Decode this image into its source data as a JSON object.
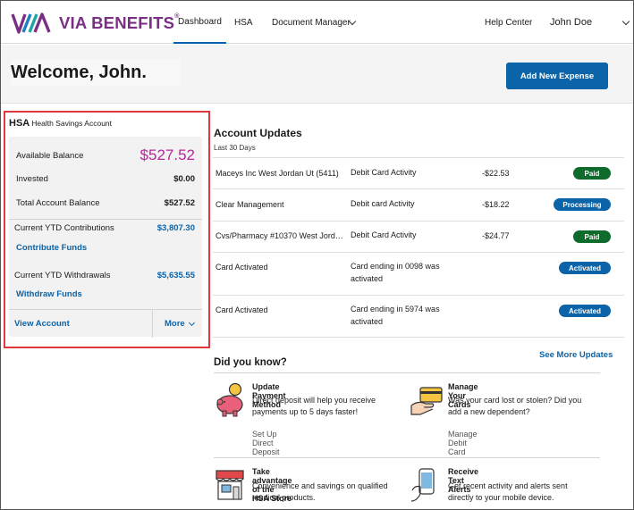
{
  "brand": {
    "name": "VIA BENEFITS",
    "mark": "®"
  },
  "nav": {
    "dashboard": "Dashboard",
    "hsa": "HSA",
    "document_manager": "Document Manager",
    "help_center": "Help Center",
    "user_name": "John Doe"
  },
  "welcome": {
    "text": "Welcome, John.",
    "add_expense": "Add New Expense"
  },
  "hsa": {
    "title": "HSA",
    "subtitle": "Health Savings Account",
    "available_label": "Available Balance",
    "available_value": "$527.52",
    "invested_label": "Invested",
    "invested_value": "$0.00",
    "total_label": "Total Account Balance",
    "total_value": "$527.52",
    "contrib_label": "Current YTD Contributions",
    "contrib_value": "$3,807.30",
    "contrib_link": "Contribute Funds",
    "withdraw_label": "Current YTD Withdrawals",
    "withdraw_value": "$5,635.55",
    "withdraw_link": "Withdraw Funds",
    "view_account": "View Account",
    "more": "More"
  },
  "updates": {
    "title": "Account Updates",
    "subtitle": "Last 30 Days",
    "see_more": "See More Updates",
    "rows": [
      {
        "merchant": "Maceys Inc West Jordan Ut (5411)",
        "type": "Debit Card Activity",
        "amount": "-$22.53",
        "status": "Paid"
      },
      {
        "merchant": "Clear Management",
        "type": "Debit card Activity",
        "amount": "-$18.22",
        "status": "Processing"
      },
      {
        "merchant": "Cvs/Pharmacy #10370 West Jord…",
        "type": "Debit Card Activity",
        "amount": "-$24.77",
        "status": "Paid"
      },
      {
        "merchant": "Card Activated",
        "type": "Card ending in 0098 was activated",
        "amount": "",
        "status": "Activated"
      },
      {
        "merchant": "Card Activated",
        "type": "Card ending in 5974 was activated",
        "amount": "",
        "status": "Activated"
      }
    ]
  },
  "did_you_know": {
    "title": "Did you know?",
    "tips": [
      {
        "icon": "piggy-bank-icon",
        "title": "Update Payment Method",
        "body": "Direct deposit will help you receive payments up to 5 days faster!",
        "link": "Set Up Direct Deposit"
      },
      {
        "icon": "card-in-hand-icon",
        "title": "Manage Your Cards",
        "body": "Was your card lost or stolen? Did you add a new dependent?",
        "link": "Manage Debit Card"
      },
      {
        "icon": "storefront-icon",
        "title": "Take advantage of the HSA Store",
        "body": "Convenience and savings on qualified medical products.",
        "link": ""
      },
      {
        "icon": "phone-in-hand-icon",
        "title": "Receive Text Alerts",
        "body": "Get recent activity and alerts sent directly to your mobile device.",
        "link": ""
      }
    ]
  },
  "colors": {
    "brand_purple": "#7a2f85",
    "primary_blue": "#0b63a8",
    "paid_green": "#0e6b2b",
    "highlight_red": "#e0393b",
    "balance_magenta": "#b5289c"
  }
}
